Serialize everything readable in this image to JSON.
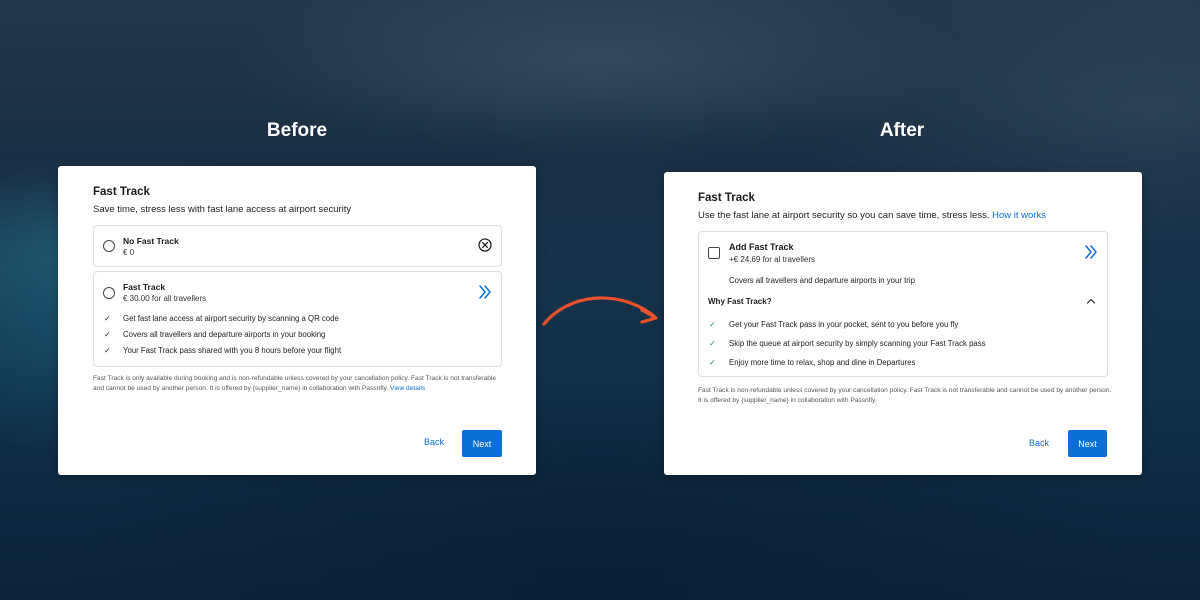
{
  "headings": {
    "before": "Before",
    "after": "After"
  },
  "before": {
    "title": "Fast Track",
    "subtitle": "Save time, stress less with fast lane access at airport security",
    "options": [
      {
        "name": "No Fast Track",
        "price": "€ 0"
      },
      {
        "name": "Fast Track",
        "price": "€ 30.00 for all travellers"
      }
    ],
    "benefits": [
      "Get fast lane access at airport security by scanning a QR code",
      "Covers all travellers and departure airports in your booking",
      "Your Fast Track pass shared with you 8 hours before your flight"
    ],
    "fineprint": "Fast Track is only available during booking and is non-refundable unless covered by your cancellation policy. Fast Track is not transferable and cannot be used by another person. It is offered by {supplier_name} in collaboration with Passnfly.",
    "view_details": "View details",
    "back_label": "Back",
    "next_label": "Next"
  },
  "after": {
    "title": "Fast Track",
    "subtitle": "Use the fast lane at airport security so you can save time, stress less.",
    "how_it_works": "How it works",
    "option": {
      "name": "Add Fast Track",
      "price": "+€ 24.69 for al travellers"
    },
    "coverage": "Covers all travellers and departure airports in your trip",
    "why_label": "Why Fast Track?",
    "benefits": [
      "Get your Fast Track pass in your pocket, sent to you before you fly",
      "Skip the queue at airport security by simply scanning your Fast Track pass",
      "Enjoy more time to relax, shop and dine in Departures"
    ],
    "fineprint": "Fast Track is non-refundable unless covered by your cancellation policy. Fast Track is not transferable and cannot be used by another person. It is offered by {supplier_name} in collaboration with Passnfly.",
    "back_label": "Back",
    "next_label": "Next"
  },
  "icons": {
    "close": "close-circle-icon",
    "chevrons": "double-chevron-right-icon",
    "check": "checkmark-icon",
    "collapse": "chevron-up-icon",
    "arrow": "curved-arrow-icon"
  },
  "colors": {
    "accent": "#0a6fd6",
    "check_before": "#222222",
    "check_after": "#1a9a46",
    "arrow": "#e8522a"
  }
}
